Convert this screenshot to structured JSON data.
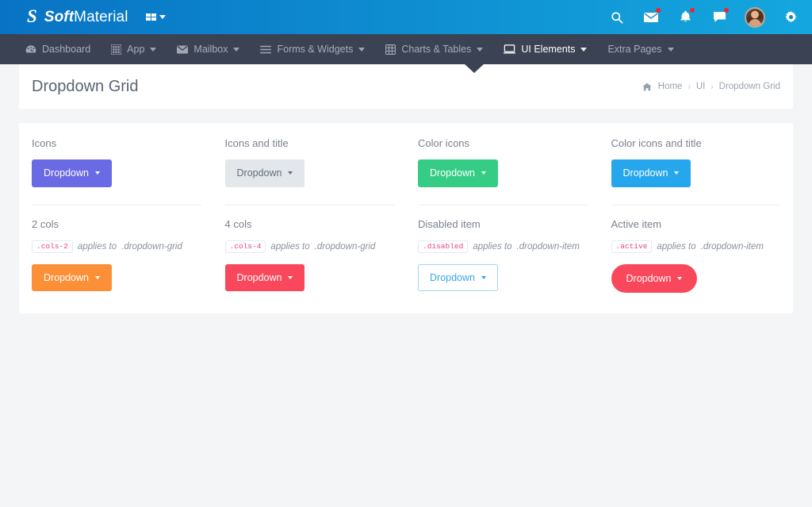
{
  "topbar": {
    "brand_logo_glyph": "S",
    "brand_bold": "Soft",
    "brand_light": "Material",
    "grid_toggle_name": "grid-apps-toggle",
    "icons": [
      {
        "name": "search-icon",
        "badge": false
      },
      {
        "name": "mail-icon",
        "badge": true
      },
      {
        "name": "bell-icon",
        "badge": true
      },
      {
        "name": "chat-icon",
        "badge": true
      }
    ],
    "avatar_name": "user-avatar",
    "settings_name": "gear-icon"
  },
  "nav": {
    "items": [
      {
        "label": "Dashboard",
        "icon": "speedometer-icon",
        "caret": false,
        "active": false
      },
      {
        "label": "App",
        "icon": "apps-grid-icon",
        "caret": true,
        "active": false
      },
      {
        "label": "Mailbox",
        "icon": "envelope-icon",
        "caret": true,
        "active": false
      },
      {
        "label": "Forms & Widgets",
        "icon": "list-lines-icon",
        "caret": true,
        "active": false
      },
      {
        "label": "Charts & Tables",
        "icon": "table-icon",
        "caret": true,
        "active": false
      },
      {
        "label": "UI Elements",
        "icon": "monitor-icon",
        "caret": true,
        "active": true
      },
      {
        "label": "Extra Pages",
        "icon": "",
        "caret": true,
        "active": false
      }
    ]
  },
  "page_header": {
    "title": "Dropdown Grid",
    "breadcrumb": [
      {
        "label": "Home",
        "icon": "home-icon",
        "current": false
      },
      {
        "label": "UI",
        "icon": "",
        "current": false
      },
      {
        "label": "Dropdown Grid",
        "icon": "",
        "current": true
      }
    ],
    "separator": "›"
  },
  "cards": {
    "row1": [
      {
        "title": "Icons",
        "button_label": "Dropdown",
        "style": "dd-purple"
      },
      {
        "title": "Icons and title",
        "button_label": "Dropdown",
        "style": "dd-light"
      },
      {
        "title": "Color icons",
        "button_label": "Dropdown",
        "style": "dd-green"
      },
      {
        "title": "Color icons and title",
        "button_label": "Dropdown",
        "style": "dd-blue"
      }
    ],
    "row2": [
      {
        "title": "2 cols",
        "code": ".cols-2",
        "note_prefix": "applies to",
        "note_target": ".dropdown-grid",
        "button_label": "Dropdown",
        "style": "dd-orange"
      },
      {
        "title": "4 cols",
        "code": ".cols-4",
        "note_prefix": "applies to",
        "note_target": ".dropdown-grid",
        "button_label": "Dropdown",
        "style": "dd-red"
      },
      {
        "title": "Disabled item",
        "code": ".disabled",
        "note_prefix": "applies to",
        "note_target": ".dropdown-item",
        "button_label": "Dropdown",
        "style": "dd-outline"
      },
      {
        "title": "Active item",
        "code": ".active",
        "note_prefix": "applies to",
        "note_target": ".dropdown-item",
        "button_label": "Dropdown",
        "style": "dd-pill"
      }
    ]
  },
  "colors": {
    "topbar_gradient_start": "#0873c4",
    "topbar_gradient_end": "#14a7de",
    "navbar": "#3b4253",
    "page_bg": "#f4f5f7",
    "card_bg": "#ffffff",
    "purple": "#6a6ae4",
    "light": "#e3e6ea",
    "green": "#35cd86",
    "blue": "#26a6ec",
    "orange": "#fb9038",
    "red": "#f9485b",
    "outline_border": "#9fd6f3",
    "code_text": "#e8428c",
    "badge_dot": "#f4212e"
  }
}
